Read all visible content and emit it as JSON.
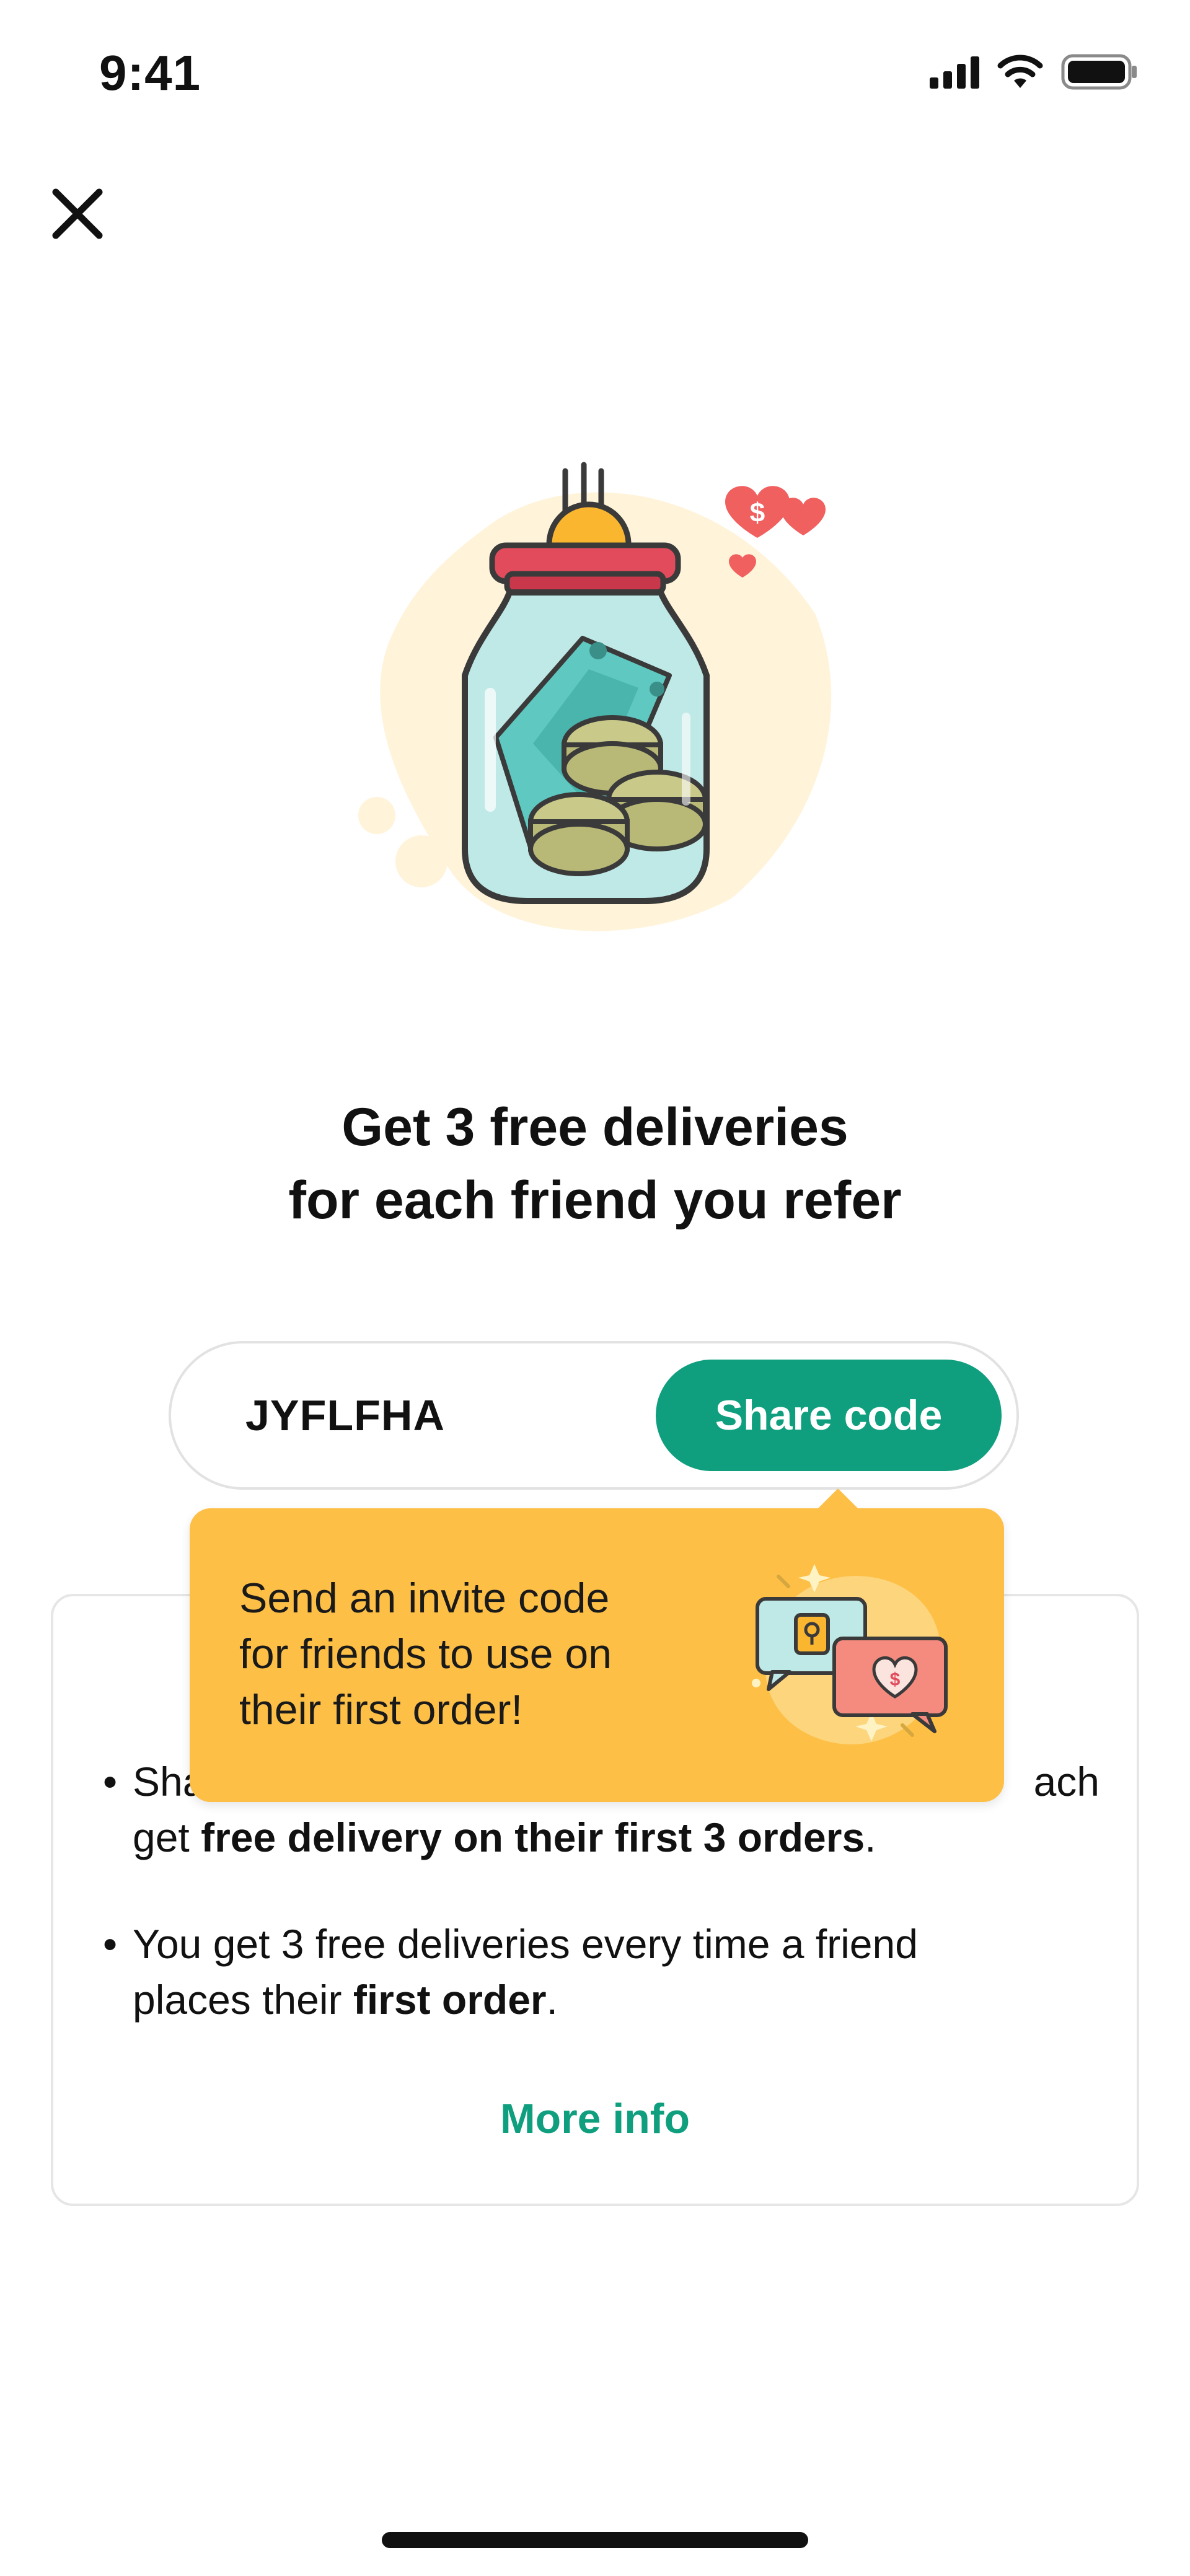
{
  "status_bar": {
    "time": "9:41"
  },
  "close": {
    "icon": "close-icon"
  },
  "headline": {
    "line1": "Get 3 free deliveries",
    "line2": "for each friend you refer"
  },
  "referral": {
    "code": "JYFLFHA",
    "share_label": "Share code"
  },
  "tooltip": {
    "line1": "Send an invite code",
    "line2": "for friends to use on",
    "line3": "their first order!"
  },
  "info_card": {
    "bullet_symbol": "•",
    "bullet1_start": "Sha",
    "bullet1_gap": "",
    "bullet1_end": "ach",
    "bullet1_line2_prefix": "get ",
    "bullet1_line2_bold": "free delivery on their first 3 orders",
    "bullet1_line2_suffix": ".",
    "bullet2_line1": "You get 3 free deliveries every time a friend",
    "bullet2_line2_prefix": "places their ",
    "bullet2_line2_bold": "first order",
    "bullet2_line2_suffix": ".",
    "more_info_label": "More info"
  },
  "colors": {
    "accent_green": "#0f9f7e",
    "tooltip_yellow": "#fdbf45",
    "heart_red": "#f0605f",
    "jar_teal": "#5ec8c1",
    "coin_gold": "#fbb62f"
  }
}
